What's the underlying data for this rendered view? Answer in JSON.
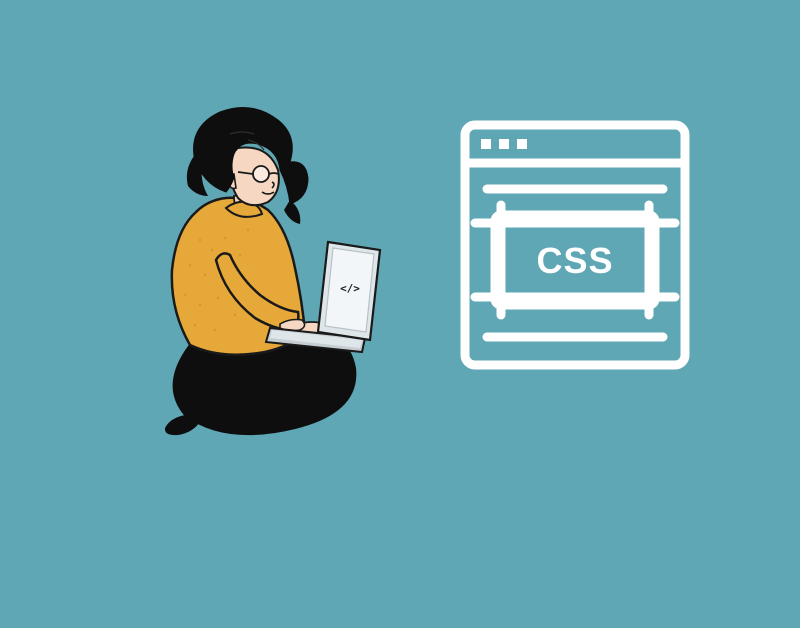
{
  "illustration": {
    "css_label": "CSS",
    "laptop_code_symbol": "</>"
  },
  "colors": {
    "background": "#5fa7b4",
    "icon_stroke": "#ffffff",
    "hair": "#0e0e0e",
    "skin": "#f6d7c1",
    "sweater": "#e6a838",
    "pants": "#0e0e0e",
    "laptop_body": "#dfe6ea",
    "laptop_screen": "#f3f6f8"
  }
}
